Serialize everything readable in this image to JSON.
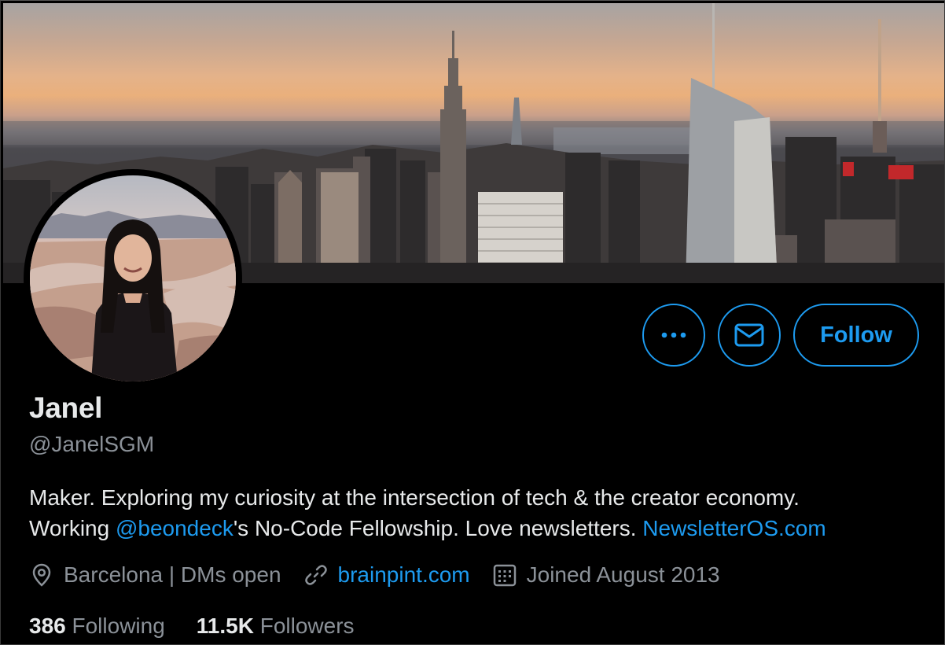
{
  "profile": {
    "name": "Janel",
    "handle": "@JanelSGM",
    "bio": {
      "line1": "Maker. Exploring my curiosity at the intersection of tech & the creator economy.",
      "line2_prefix": "Working ",
      "mention": "@beondeck",
      "line2_middle": "'s No-Code Fellowship. Love newsletters. ",
      "website_link": "NewsletterOS.com"
    },
    "location": "Barcelona | DMs open",
    "url": "brainpint.com",
    "joined": "Joined August 2013",
    "following_count": "386",
    "following_label": "Following",
    "followers_count": "11.5K",
    "followers_label": "Followers"
  },
  "actions": {
    "follow_label": "Follow",
    "more_icon": "more-icon",
    "message_icon": "mail-icon"
  },
  "icons": {
    "location": "location-pin-icon",
    "link": "link-icon",
    "calendar": "calendar-icon"
  },
  "colors": {
    "accent": "#1d9bf0",
    "background": "#000000",
    "primary_text": "#e7e9ea",
    "secondary_text": "#8b9198"
  }
}
